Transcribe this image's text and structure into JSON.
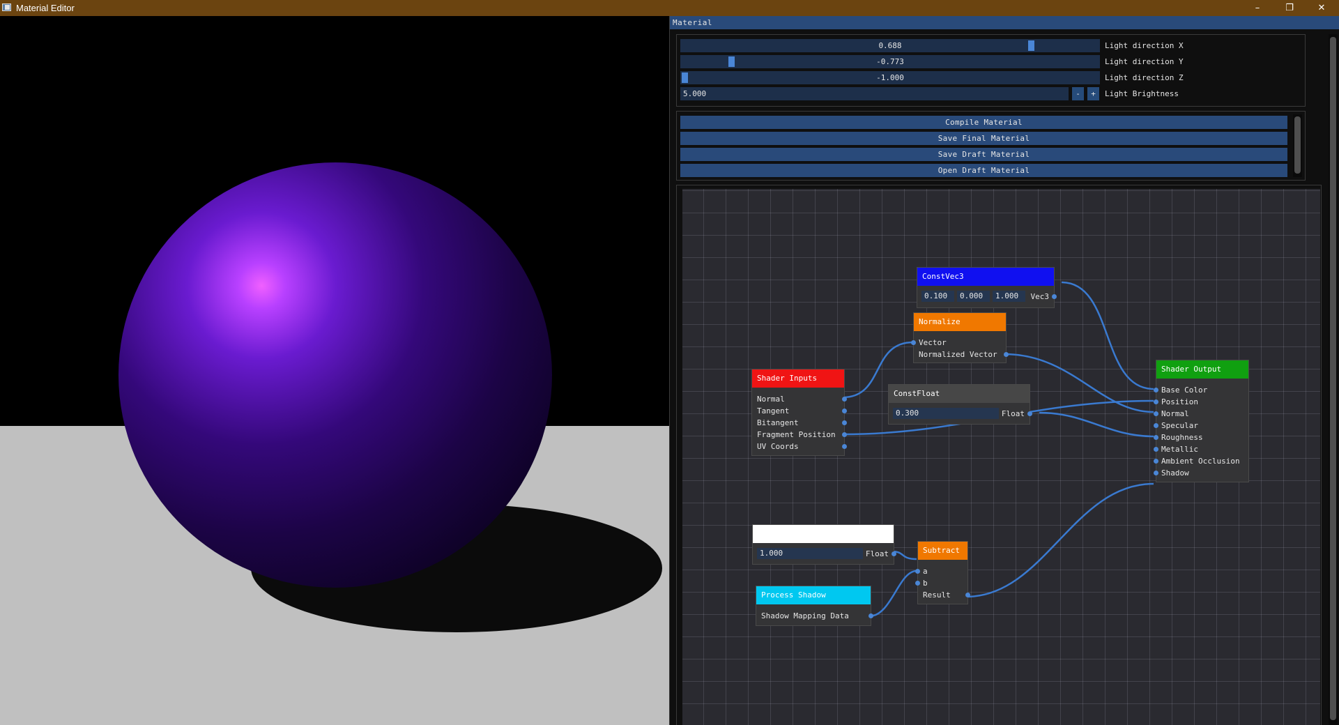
{
  "window": {
    "title": "Material Editor",
    "minimize": "–",
    "restore": "❐",
    "close": "✕"
  },
  "colors": {
    "titlebar": "#6b4410",
    "accent": "#294a7a",
    "slider_grab": "#4a86d6",
    "sphere": "#3a0880",
    "floor": "#c0c0c0"
  },
  "panel": {
    "title": "Material",
    "light": {
      "x": {
        "value": "0.688",
        "label": "Light direction X",
        "level": 0.844
      },
      "y": {
        "value": "-0.773",
        "label": "Light direction Y",
        "level": 0.114
      },
      "z": {
        "value": "-1.000",
        "label": "Light direction Z",
        "level": 0.0
      },
      "brightness": {
        "value": "5.000",
        "label": "Light Brightness",
        "minus": "-",
        "plus": "+"
      }
    },
    "buttons": {
      "compile": "Compile Material",
      "save_final": "Save Final Material",
      "save_draft": "Save Draft Material",
      "open_draft": "Open Draft Material"
    }
  },
  "nodes": {
    "const_vec3": {
      "title": "ConstVec3",
      "color": "#1010f0",
      "x": "0.100",
      "y": "0.000",
      "z": "1.000",
      "out": "Vec3"
    },
    "normalize": {
      "title": "Normalize",
      "color": "#f07800",
      "in": "Vector",
      "out": "Normalized Vector"
    },
    "shader_inputs": {
      "title": "Shader Inputs",
      "color": "#f01414",
      "outputs": [
        "Normal",
        "Tangent",
        "Bitangent",
        "Fragment Position",
        "UV Coords"
      ]
    },
    "const_float": {
      "title": "ConstFloat",
      "color": "#474747",
      "value": "0.300",
      "out": "Float"
    },
    "shader_output": {
      "title": "Shader Output",
      "color": "#10a010",
      "inputs": [
        "Base Color",
        "Position",
        "Normal",
        "Specular",
        "Roughness",
        "Metallic",
        "Ambient Occlusion",
        "Shadow"
      ]
    },
    "unnamed_float": {
      "title": "",
      "color": "#ffffff",
      "value": "1.000",
      "out": "Float"
    },
    "subtract": {
      "title": "Subtract",
      "color": "#f07800",
      "a": "a",
      "b": "b",
      "out": "Result"
    },
    "process_shadow": {
      "title": "Process Shadow",
      "color": "#00c8f0",
      "out": "Shadow Mapping Data"
    }
  }
}
